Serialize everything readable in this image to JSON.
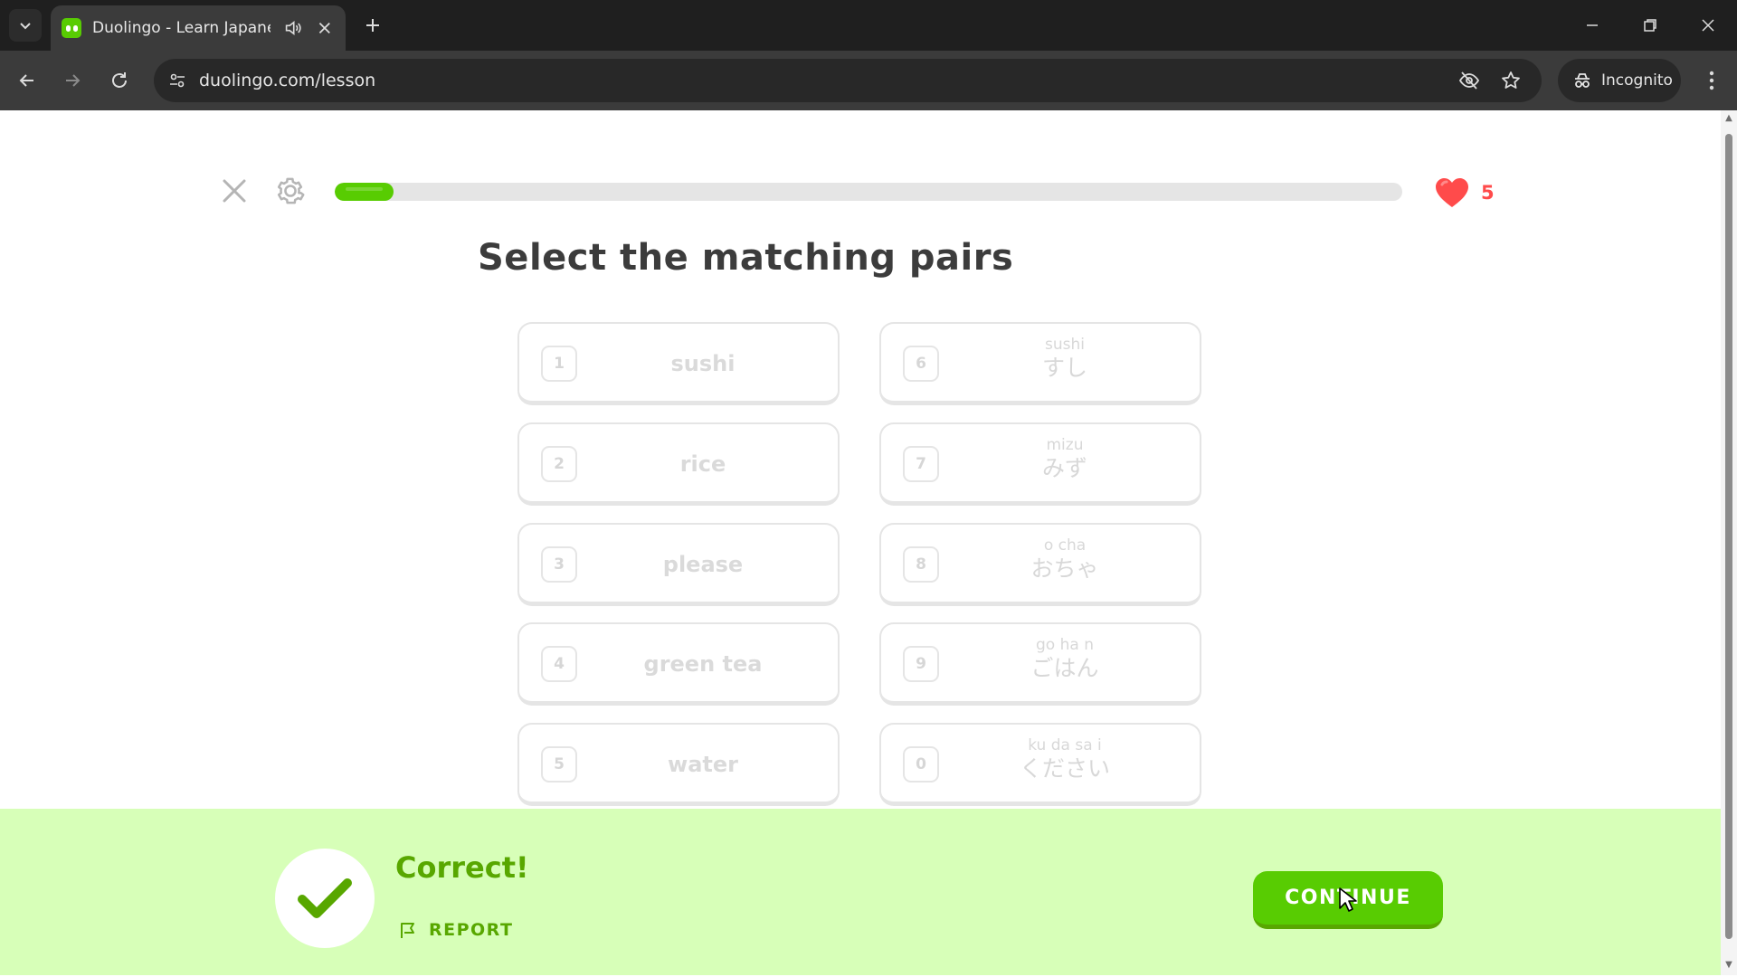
{
  "browser": {
    "tab_title": "Duolingo - Learn Japanese",
    "url": "duolingo.com/lesson",
    "incognito_label": "Incognito"
  },
  "lesson": {
    "progress_fraction": 0.055,
    "hearts": "5",
    "prompt": "Select the matching pairs",
    "left_tiles": [
      {
        "num": "1",
        "text": "sushi"
      },
      {
        "num": "2",
        "text": "rice"
      },
      {
        "num": "3",
        "text": "please"
      },
      {
        "num": "4",
        "text": "green tea"
      },
      {
        "num": "5",
        "text": "water"
      }
    ],
    "right_tiles": [
      {
        "num": "6",
        "romaji": "sushi",
        "kana": "すし"
      },
      {
        "num": "7",
        "romaji": "mizu",
        "kana": "みず"
      },
      {
        "num": "8",
        "romaji": "o cha",
        "kana": "おちゃ"
      },
      {
        "num": "9",
        "romaji": "go ha n",
        "kana": "ごはん"
      },
      {
        "num": "0",
        "romaji": "ku da sa i",
        "kana": "ください"
      }
    ]
  },
  "feedback": {
    "title": "Correct!",
    "report_label": "REPORT",
    "continue_label": "CONTINUE"
  },
  "colors": {
    "brand_green": "#58cc02",
    "feedback_bg": "#d7ffb8",
    "feedback_text": "#58a700",
    "heart_red": "#ff4b4b"
  },
  "icons": [
    "tab-dropdown-icon",
    "duolingo-favicon",
    "audio-icon",
    "close-icon",
    "plus-icon",
    "minimize-icon",
    "restore-icon",
    "window-close-icon",
    "back-icon",
    "forward-icon",
    "reload-icon",
    "site-info-icon",
    "eye-off-icon",
    "star-icon",
    "incognito-icon",
    "kebab-menu-icon",
    "gear-icon",
    "heart-icon",
    "checkmark-icon",
    "flag-icon"
  ]
}
